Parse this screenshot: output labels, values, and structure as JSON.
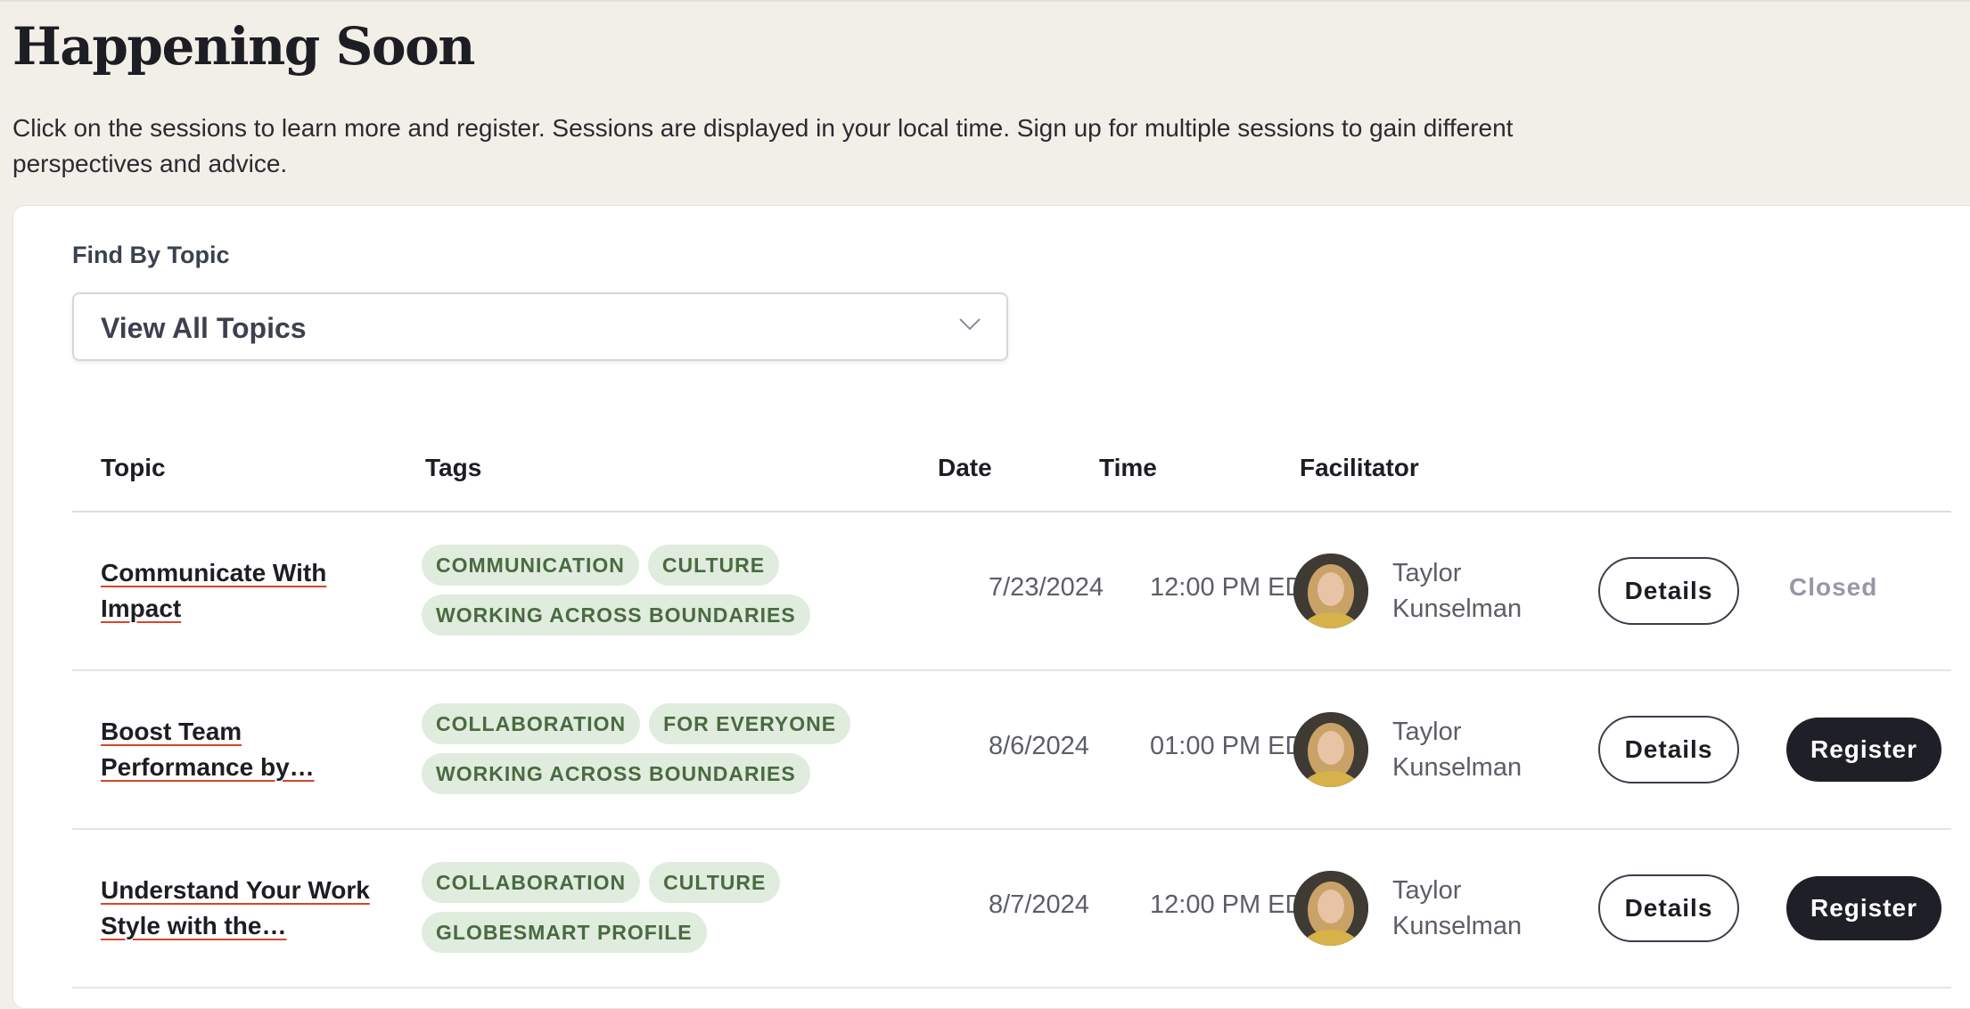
{
  "page": {
    "title": "Happening Soon",
    "intro": "Click on the sessions to learn more and register. Sessions are displayed in your local time. Sign up for multiple sessions to gain different perspectives and advice."
  },
  "filter": {
    "label": "Find By Topic",
    "selected": "View All Topics",
    "icon": "chevron-down-icon"
  },
  "table": {
    "headers": {
      "topic": "Topic",
      "tags": "Tags",
      "date": "Date",
      "time": "Time",
      "facilitator": "Facilitator"
    },
    "rows": [
      {
        "topic": "Communicate With Impact",
        "tags": [
          "COMMUNICATION",
          "CULTURE",
          "WORKING ACROSS BOUNDARIES"
        ],
        "date": "7/23/2024",
        "time": "12:00 PM EDT",
        "facilitator": "Taylor Kunselman",
        "details_label": "Details",
        "status": "Closed"
      },
      {
        "topic": "Boost Team Performance by…",
        "tags": [
          "COLLABORATION",
          "FOR EVERYONE",
          "WORKING ACROSS BOUNDARIES"
        ],
        "date": "8/6/2024",
        "time": "01:00 PM EDT",
        "facilitator": "Taylor Kunselman",
        "details_label": "Details",
        "register_label": "Register"
      },
      {
        "topic": "Understand Your Work Style with the…",
        "tags": [
          "COLLABORATION",
          "CULTURE",
          "GLOBESMART PROFILE"
        ],
        "date": "8/7/2024",
        "time": "12:00 PM EDT",
        "facilitator": "Taylor Kunselman",
        "details_label": "Details",
        "register_label": "Register"
      }
    ]
  },
  "colors": {
    "page_bg": "#f2efe8",
    "tag_bg": "#e0ecdd",
    "tag_text": "#4a6a42",
    "link_underline": "#d9452b",
    "register_bg": "#1f2027",
    "closed_text": "#9a96a8"
  }
}
